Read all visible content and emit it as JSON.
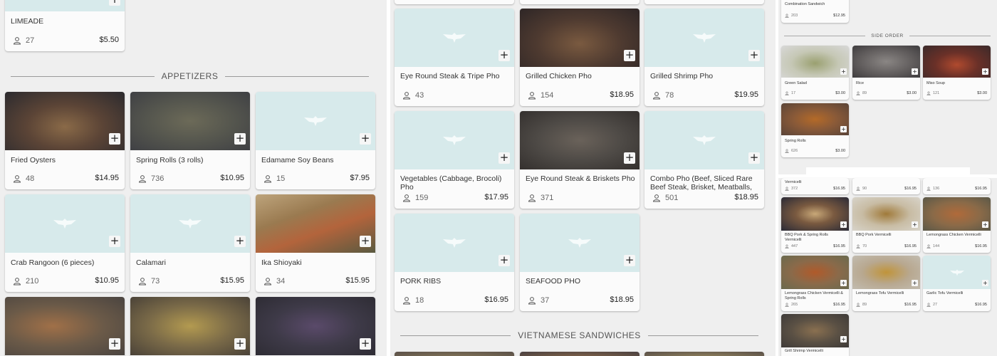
{
  "left_panel": {
    "top_item": {
      "name": "LIMEADE",
      "count": "27",
      "price": "$5.50"
    },
    "section_title": "APPETIZERS",
    "items": [
      {
        "name": "Fried Oysters",
        "count": "48",
        "price": "$14.95"
      },
      {
        "name": "Spring Rolls (3 rolls)",
        "count": "736",
        "price": "$10.95"
      },
      {
        "name": "Edamame Soy Beans",
        "count": "15",
        "price": "$7.95"
      },
      {
        "name": "Crab Rangoon (6 pieces)",
        "count": "210",
        "price": "$10.95"
      },
      {
        "name": "Calamari",
        "count": "73",
        "price": "$15.95"
      },
      {
        "name": "Ika Shioyaki",
        "count": "34",
        "price": "$15.95"
      }
    ]
  },
  "middle_panel": {
    "items": [
      {
        "name": "Eye Round Steak & Tripe Pho",
        "count": "43",
        "price": ""
      },
      {
        "name": "Grilled Chicken Pho",
        "count": "154",
        "price": "$18.95"
      },
      {
        "name": "Grilled Shrimp Pho",
        "count": "78",
        "price": "$19.95"
      },
      {
        "name": "Vegetables (Cabbage, Brocoli) Pho",
        "count": "159",
        "price": "$17.95"
      },
      {
        "name": "Eye Round Steak & Briskets Pho",
        "count": "371",
        "price": ""
      },
      {
        "name": "Combo Pho (Beef, Sliced Rare Beef Steak, Brisket, Meatballs,",
        "count": "501",
        "price": "$18.95"
      },
      {
        "name": "PORK RIBS",
        "count": "18",
        "price": "$16.95"
      },
      {
        "name": "SEAFOOD PHO",
        "count": "37",
        "price": "$18.95"
      }
    ],
    "section_title": "VIETNAMESE SANDWICHES"
  },
  "right_panel": {
    "top_item": {
      "name": "Combination Sandwich",
      "count": "203",
      "price": "$12.95"
    },
    "section_title": "SIDE ORDER",
    "side_items": [
      {
        "name": "Green Salad",
        "count": "17",
        "price": "$3.00"
      },
      {
        "name": "Rice",
        "count": "89",
        "price": "$3.00"
      },
      {
        "name": "Miso Soup",
        "count": "121",
        "price": "$3.00"
      },
      {
        "name": "Spring Rolls",
        "count": "626",
        "price": "$3.00"
      }
    ],
    "lower_partial": [
      {
        "name": "Vermicelli",
        "count": "372",
        "price": "$16.95"
      },
      {
        "name": "",
        "count": "90",
        "price": "$16.95"
      },
      {
        "name": "",
        "count": "136",
        "price": "$16.95"
      }
    ],
    "lower_items": [
      {
        "name": "BBQ Pork & Spring Rolls Vermicelli",
        "count": "447",
        "price": "$16.95"
      },
      {
        "name": "BBQ Pork Vermicelli",
        "count": "70",
        "price": "$16.95"
      },
      {
        "name": "Lemongrass Chicken Vermicelli",
        "count": "144",
        "price": "$16.95"
      },
      {
        "name": "Lemongrass Chicken Vermicelli & Spring Rolls",
        "count": "265",
        "price": "$16.95"
      },
      {
        "name": "Lemongrass Tofu Vermicelli",
        "count": "89",
        "price": "$16.95"
      },
      {
        "name": "Garlic Tofu Vermicelli",
        "count": "27",
        "price": "$16.95"
      },
      {
        "name": "Grill Shrimp Vermicelli",
        "count": "",
        "price": ""
      }
    ]
  },
  "icons": {
    "add": "plus-icon",
    "people": "user-icon",
    "placeholder": "logo-wings-icon"
  },
  "colors": {
    "panel_bg": "#efefef",
    "placeholder_bg": "#d7eaeb",
    "card_bg": "#fbfbfb"
  }
}
